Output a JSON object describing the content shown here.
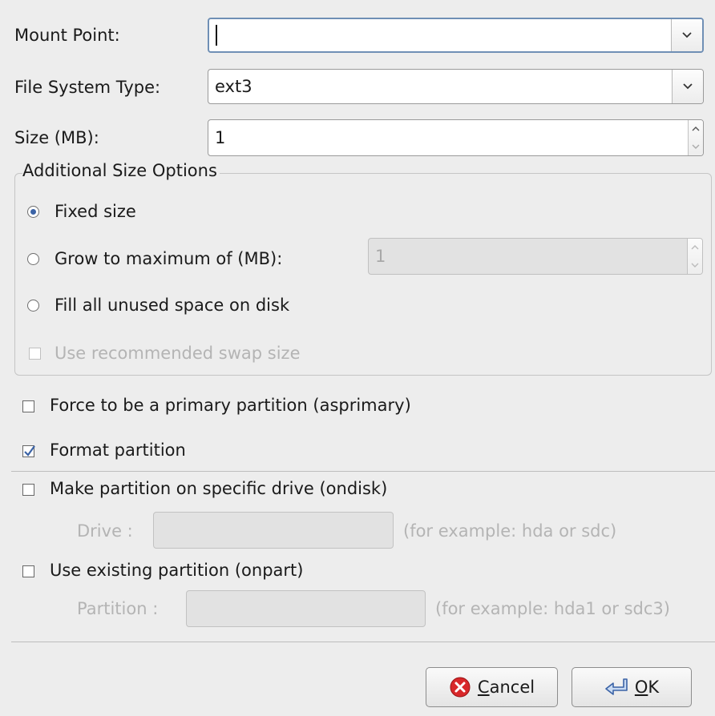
{
  "mount_point": {
    "label": "Mount Point:",
    "value": ""
  },
  "fs_type": {
    "label": "File System Type:",
    "value": "ext3"
  },
  "size": {
    "label": "Size (MB):",
    "value": "1"
  },
  "size_options": {
    "title": "Additional Size Options",
    "fixed": "Fixed size",
    "grow": "Grow to maximum of (MB):",
    "grow_value": "1",
    "fill": "Fill all unused space on disk",
    "swap": "Use recommended swap size"
  },
  "primary": "Force to be a primary partition (asprimary)",
  "format": "Format partition",
  "ondisk": {
    "label": "Make partition on specific drive (ondisk)",
    "drive_label": "Drive :",
    "drive_hint": "(for example: hda or sdc)"
  },
  "onpart": {
    "label": "Use existing partition (onpart)",
    "partition_label": "Partition :",
    "partition_hint": "(for example: hda1 or sdc3)"
  },
  "buttons": {
    "cancel_mnemonic": "C",
    "cancel_rest": "ancel",
    "ok_mnemonic": "O",
    "ok_rest": "K"
  },
  "colors": {
    "accent": "#3b63a6",
    "cancel_icon": "#d8282a",
    "focus": "#6f8fb5"
  }
}
